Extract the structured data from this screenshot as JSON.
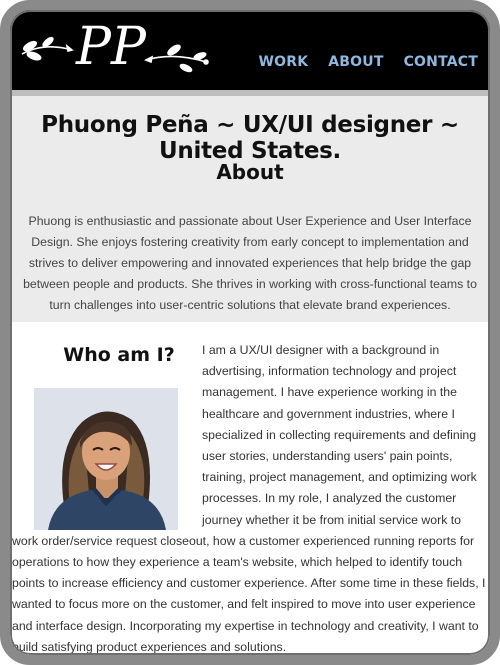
{
  "logo": {
    "text": "PP",
    "icon": "leaf-vine-ornament"
  },
  "nav": {
    "items": [
      "WORK",
      "ABOUT",
      "CONTACT"
    ]
  },
  "hero": {
    "title": "Phuong Peña ~ UX/UI designer ~ United States.",
    "subtitle": "About",
    "summary": "Phuong is enthusiastic and passionate about User Experience and User Interface Design. She enjoys fostering creativity from early concept to implementation and strives to deliver empowering and innovated experiences that help bridge the gap between people and products. She thrives in working with cross-functional teams to turn challenges into user-centric solutions that elevate brand experiences."
  },
  "who": {
    "heading": "Who am I?",
    "photo_alt": "portrait-photo",
    "bio": "I am a UX/UI designer with a background in advertising, information technology and project management. I have experience working in the healthcare and government industries, where I specialized in collecting requirements and defining user stories, understanding users' pain points, training, project management, and optimizing work processes. In my role, I analyzed the customer journey whether it be from initial service work to work order/service request closeout, how a customer experienced running reports for operations to how they experience a team's website, which helped to identify touch points to increase efficiency and customer experience. After some time in these fields, I wanted to focus more on the customer, and felt inspired to move into user experience and interface design. Incorporating my expertise in technology and creativity, I want to build satisfying product experiences and solutions."
  },
  "colors": {
    "header_bg": "#000000",
    "nav_link": "#8fb8e0",
    "hero_bg": "#ebebeb"
  }
}
